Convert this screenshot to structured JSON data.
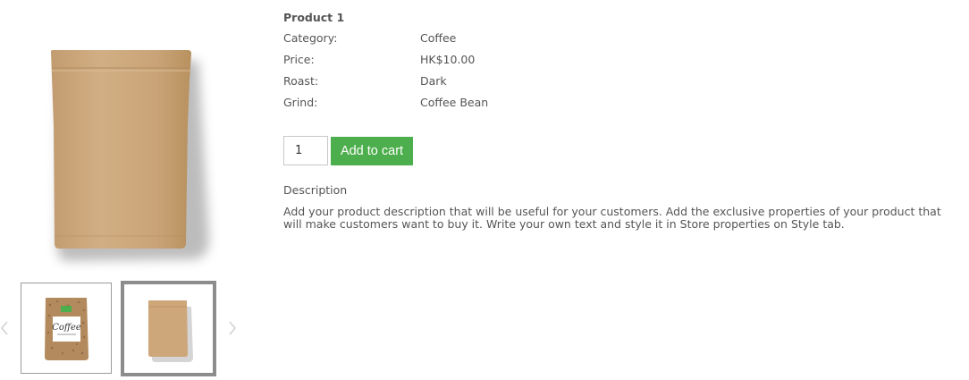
{
  "product": {
    "name": "Product 1",
    "specs": [
      {
        "label": "Category:",
        "value": "Coffee"
      },
      {
        "label": "Price:",
        "value": "HK$10.00"
      },
      {
        "label": "Roast:",
        "value": "Dark"
      },
      {
        "label": "Grind:",
        "value": "Coffee Bean"
      }
    ]
  },
  "cart": {
    "quantity": "1",
    "add_label": "Add to cart"
  },
  "description": {
    "title": "Description",
    "text": "Add your product description that will be useful for your customers. Add the exclusive properties of your product that will make customers want to buy it. Write your own text and style it in Store properties on Style tab."
  },
  "gallery": {
    "thumbnail_label": "Coffee",
    "selected_index": 1,
    "prev_icon": "chevron-left-icon",
    "next_icon": "chevron-right-icon"
  },
  "colors": {
    "button": "#4cae4c",
    "kraft": "#c9a57b",
    "text": "#555555"
  }
}
